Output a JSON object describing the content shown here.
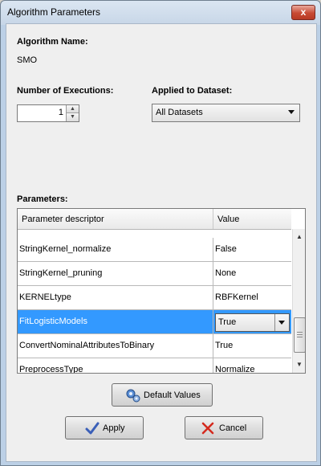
{
  "window": {
    "title": "Algorithm Parameters",
    "close_glyph": "x"
  },
  "algorithm": {
    "label": "Algorithm Name:",
    "value": "SMO"
  },
  "executions": {
    "label": "Number of Executions:",
    "value": "1"
  },
  "dataset": {
    "label": "Applied to Dataset:",
    "selected": "All Datasets"
  },
  "parameters": {
    "label": "Parameters:",
    "columns": [
      "Parameter descriptor",
      "Value"
    ],
    "rows": [
      {
        "name": "StringKernel_normalize",
        "value": "False"
      },
      {
        "name": "StringKernel_pruning",
        "value": "None"
      },
      {
        "name": "KERNELtype",
        "value": "RBFKernel"
      },
      {
        "name": "FitLogisticModels",
        "value": "True"
      },
      {
        "name": "ConvertNominalAttributesToBinary",
        "value": "True"
      },
      {
        "name": "PreprocessType",
        "value": "Normalize"
      }
    ]
  },
  "buttons": {
    "defaults": "Default Values",
    "apply": "Apply",
    "cancel": "Cancel"
  },
  "colors": {
    "selection": "#3399ff",
    "close": "#c74a33",
    "cancel_icon": "#d42a1e",
    "apply_icon": "#3a5fb8"
  }
}
